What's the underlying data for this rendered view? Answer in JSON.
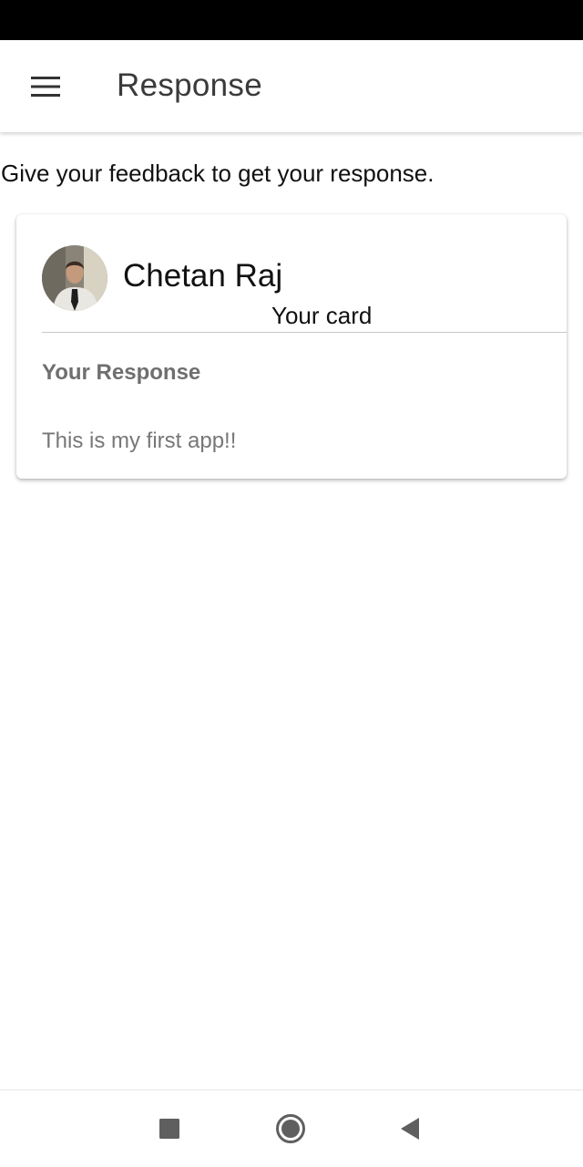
{
  "header": {
    "title": "Response",
    "menu_icon": "hamburger-menu-icon"
  },
  "intro": {
    "text": "Give your feedback to get your response."
  },
  "card": {
    "avatar_icon": "user-avatar-photo",
    "name": "Chetan Raj",
    "subtitle": "Your card",
    "response_label": "Your Response",
    "response_text": "This is my first app!!"
  },
  "navbar": {
    "recents_icon": "square-icon",
    "home_icon": "circle-home-icon",
    "back_icon": "triangle-back-icon"
  },
  "colors": {
    "status_bar": "#000000",
    "title": "#3a3a3a",
    "label": "#6f6f6f",
    "nav_icon": "#5f5f5f"
  }
}
